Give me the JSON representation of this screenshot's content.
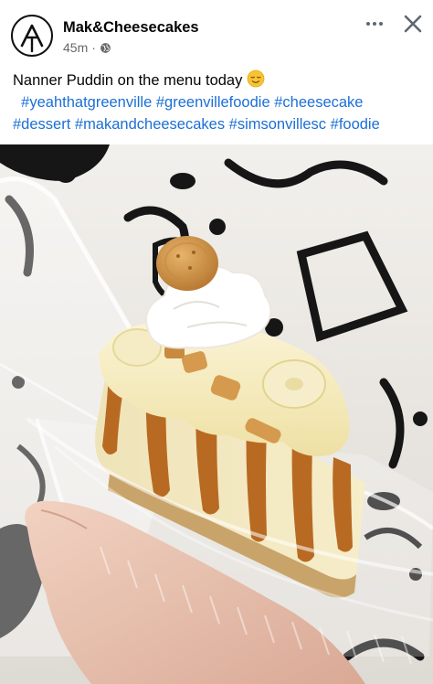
{
  "post": {
    "page_name": "Mak&Cheesecakes",
    "time_ago": "45m",
    "privacy_icon": "globe-icon",
    "caption_text": "Nanner Puddin on the menu today",
    "caption_emoji": "relieved-face-emoji",
    "hashtags_line1": [
      "#yeahthatgreenville",
      "#greenvillefoodie",
      "#cheesecake"
    ],
    "hashtags_line2": [
      "#dessert",
      "#makandcheesecakes",
      "#simsonvillesc",
      "#foodie"
    ]
  },
  "header": {
    "more_icon": "more-horizontal-icon",
    "close_icon": "close-icon"
  },
  "photo": {
    "subject": "banana pudding cheesecake slice in clear plastic container held in hand"
  },
  "colors": {
    "text": "#050505",
    "meta": "#65676b",
    "hashtag": "#1b6fd6",
    "caramel": "#b86a22"
  }
}
